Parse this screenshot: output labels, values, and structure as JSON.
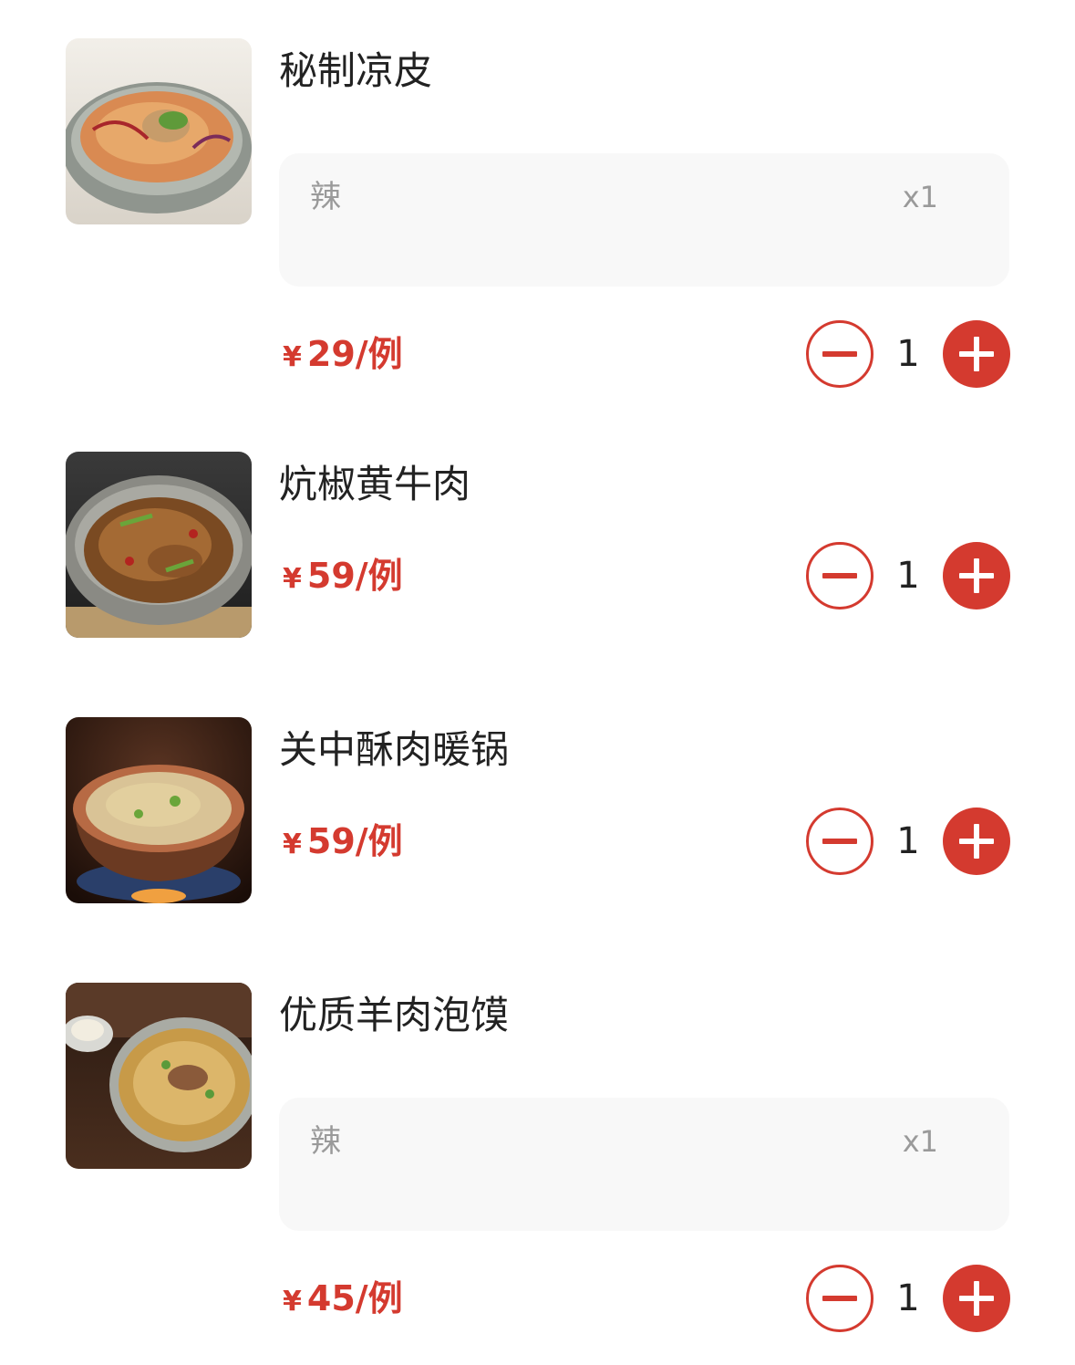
{
  "currency_symbol": "¥",
  "accent_color": "#d43a2f",
  "items": [
    {
      "name": "秘制凉皮",
      "price": "29/例",
      "quantity": "1",
      "option": {
        "label": "辣",
        "count": "x1"
      },
      "image_icon": "cold-noodles-dish-image"
    },
    {
      "name": "炕椒黄牛肉",
      "price": "59/例",
      "quantity": "1",
      "image_icon": "chili-beef-dish-image"
    },
    {
      "name": "关中酥肉暖锅",
      "price": "59/例",
      "quantity": "1",
      "image_icon": "pork-hotpot-dish-image"
    },
    {
      "name": "优质羊肉泡馍",
      "price": "45/例",
      "quantity": "1",
      "option": {
        "label": "辣",
        "count": "x1"
      },
      "image_icon": "mutton-soup-dish-image"
    }
  ]
}
